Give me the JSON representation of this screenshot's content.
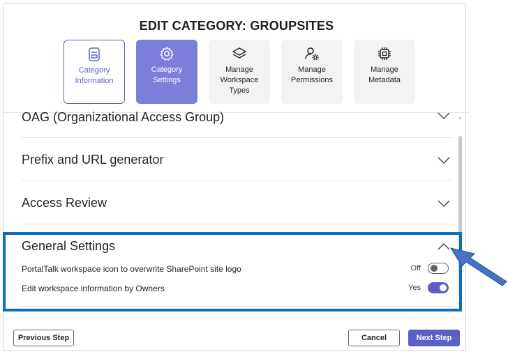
{
  "dialog": {
    "title": "EDIT CATEGORY: GROUPSITES"
  },
  "steps": [
    {
      "label": "Category Information",
      "icon": "form-icon",
      "state": "completed"
    },
    {
      "label": "Category Settings",
      "icon": "settings-icon",
      "state": "active"
    },
    {
      "label": "Manage Workspace Types",
      "icon": "layers-icon",
      "state": "default"
    },
    {
      "label": "Manage Permissions",
      "icon": "person-settings-icon",
      "state": "default"
    },
    {
      "label": "Manage Metadata",
      "icon": "chip-icon",
      "state": "default"
    }
  ],
  "sections": [
    {
      "title": "OAG (Organizational Access Group)",
      "expanded": false
    },
    {
      "title": "Prefix and URL generator",
      "expanded": false
    },
    {
      "title": "Access Review",
      "expanded": false
    },
    {
      "title": "General Settings",
      "expanded": true
    }
  ],
  "general_settings": [
    {
      "label": "PortalTalk workspace icon to overwrite SharePoint site logo",
      "state_label": "Off",
      "on": false
    },
    {
      "label": "Edit workspace information by Owners",
      "state_label": "Yes",
      "on": true
    }
  ],
  "footer": {
    "previous_label": "Previous Step",
    "cancel_label": "Cancel",
    "next_label": "Next Step"
  },
  "colors": {
    "accent": "#5b5fc7",
    "highlight": "#0b6ebf",
    "arrow": "#4472c4"
  }
}
